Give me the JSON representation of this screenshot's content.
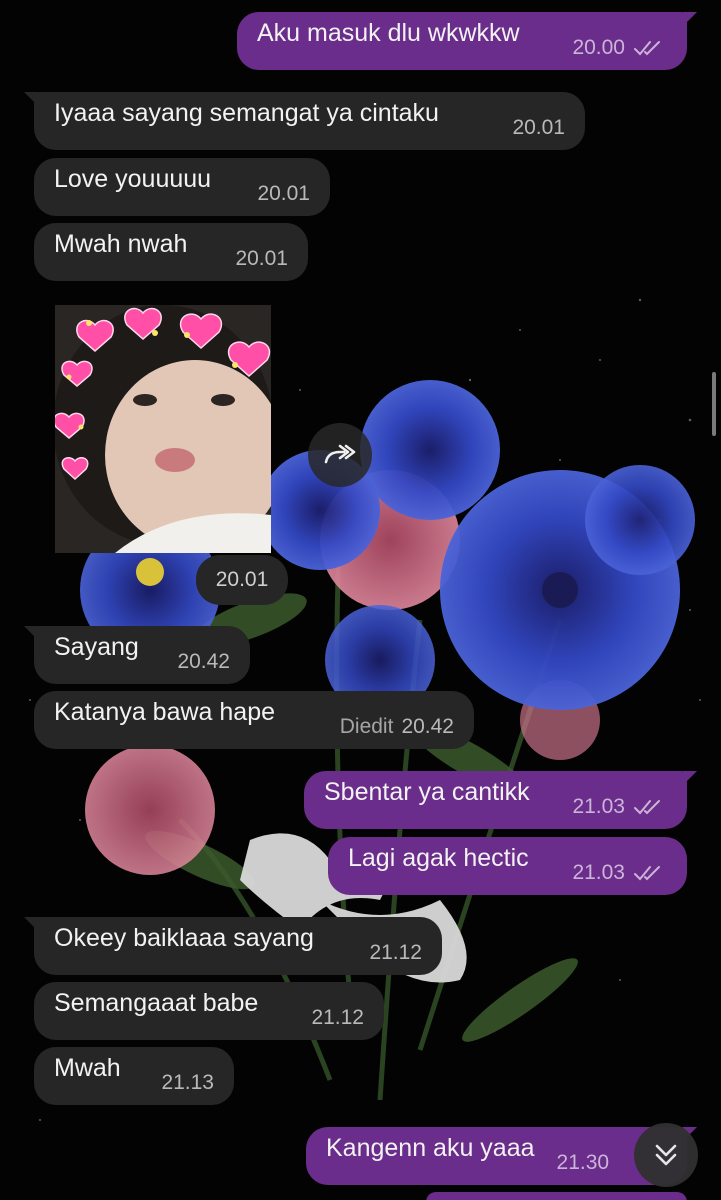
{
  "colors": {
    "incoming_bubble": "#262626",
    "outgoing_bubble": "#6b2d8b",
    "background": "#030303"
  },
  "icons": {
    "read_receipt": "double-check-icon",
    "forward": "forward-icon",
    "scroll_down": "double-chevron-down-icon"
  },
  "messages": [
    {
      "dir": "out",
      "text": "Aku masuk dlu wkwkkw",
      "time": "20.00",
      "read": true
    },
    {
      "dir": "in",
      "text": "Iyaaa sayang semangat ya cintaku",
      "time": "20.01"
    },
    {
      "dir": "in",
      "text": "Love youuuuu",
      "time": "20.01"
    },
    {
      "dir": "in",
      "text": "Mwah nwah",
      "time": "20.01"
    },
    {
      "dir": "in",
      "type": "image",
      "time": "20.01"
    },
    {
      "dir": "in",
      "text": "Sayang",
      "time": "20.42"
    },
    {
      "dir": "in",
      "text": "Katanya bawa hape",
      "edited": "Diedit",
      "time": "20.42"
    },
    {
      "dir": "out",
      "text": "Sbentar ya cantikk",
      "time": "21.03",
      "read": true
    },
    {
      "dir": "out",
      "text": "Lagi agak hectic",
      "time": "21.03",
      "read": true
    },
    {
      "dir": "in",
      "text": "Okeey baiklaaa sayang",
      "time": "21.12"
    },
    {
      "dir": "in",
      "text": "Semangaaat babe",
      "time": "21.12"
    },
    {
      "dir": "in",
      "text": "Mwah",
      "time": "21.13"
    },
    {
      "dir": "out",
      "text": "Kangenn aku yaaa",
      "time": "21.30"
    }
  ]
}
